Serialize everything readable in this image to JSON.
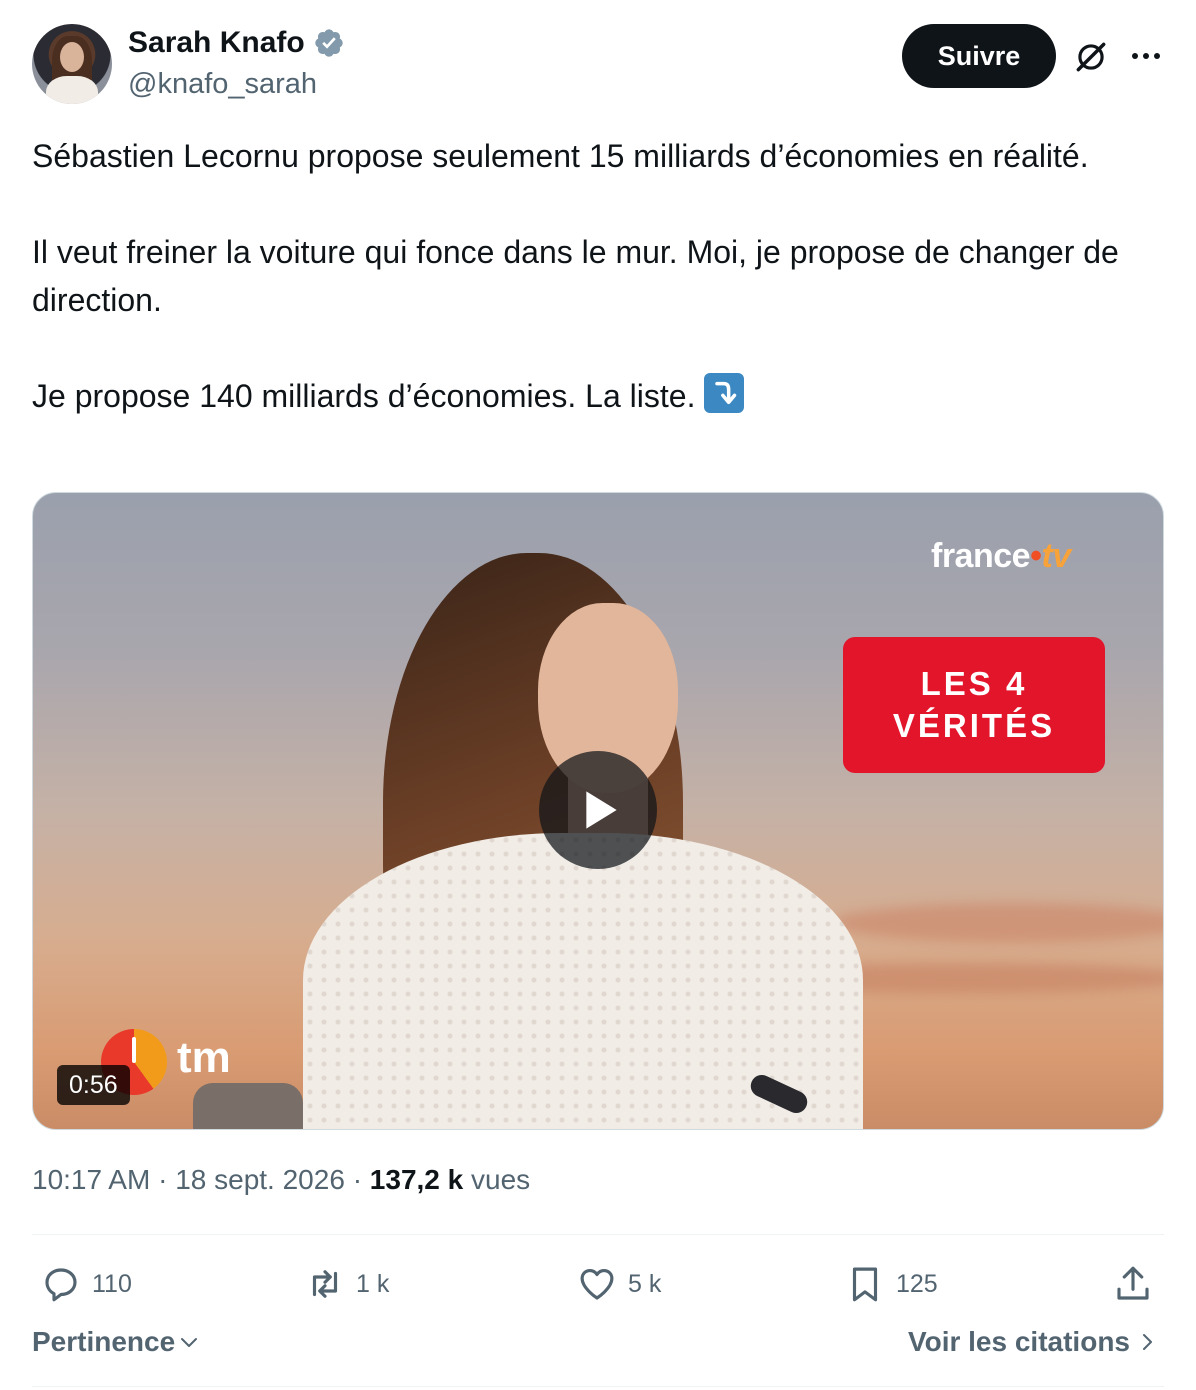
{
  "author": {
    "display_name": "Sarah Knafo",
    "handle": "@knafo_sarah",
    "verified": true
  },
  "header": {
    "follow_label": "Suivre",
    "grok_icon": "grok-icon",
    "more_icon": "more-dots-icon"
  },
  "tweet": {
    "paragraphs": [
      "Sébastien Lecornu propose seulement 15 milliards d’économies en réalité.",
      "Il veut freiner la voiture qui fonce dans le mur. Moi, je propose de changer de direction.",
      "Je propose 140 milliards d’économies. La liste."
    ],
    "trailing_emoji": "arrow-heading-down-emoji"
  },
  "media": {
    "brand_main": "france",
    "brand_dot": "•",
    "brand_tv": "tv",
    "badge_line1": "LES 4",
    "badge_line2": "VÉRITÉS",
    "corner_logo": "tm",
    "duration": "0:56"
  },
  "meta": {
    "time": "10:17 AM",
    "separator": "·",
    "date": "18 sept. 2026",
    "views_count": "137,2 k",
    "views_label": "vues"
  },
  "actions": {
    "replies": "110",
    "reposts": "1 k",
    "likes": "5 k",
    "bookmarks": "125"
  },
  "footer": {
    "sort_label": "Pertinence",
    "quotes_label": "Voir les citations"
  },
  "colors": {
    "text_primary": "#0f1419",
    "text_secondary": "#536471",
    "verified": "#829aab",
    "badge_red": "#e2152b"
  }
}
